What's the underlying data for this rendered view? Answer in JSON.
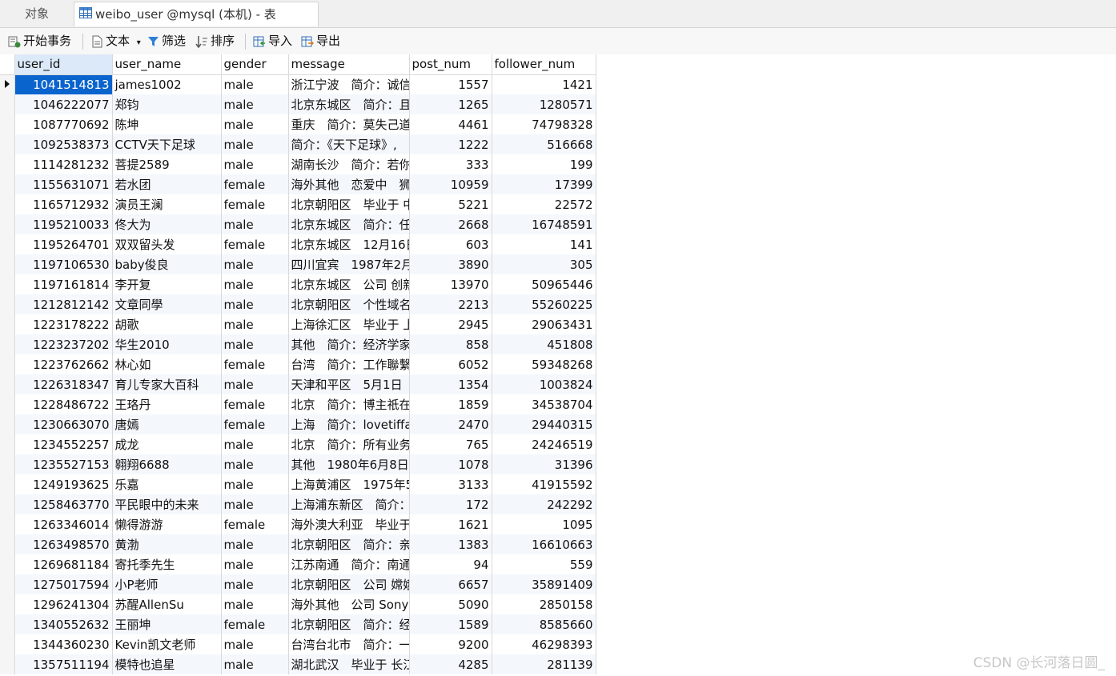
{
  "tabs": {
    "objects_label": "对象",
    "table_label": "weibo_user @mysql (本机) - 表"
  },
  "toolbar": {
    "begin_transaction": "开始事务",
    "text": "文本",
    "filter": "筛选",
    "sort": "排序",
    "import": "导入",
    "export": "导出"
  },
  "columns": [
    "user_id",
    "user_name",
    "gender",
    "message",
    "post_num",
    "follower_num"
  ],
  "rows": [
    [
      "1041514813",
      "james1002",
      "male",
      "浙江宁波　简介：诚信",
      "1557",
      "1421"
    ],
    [
      "1046222077",
      "郑钧",
      "male",
      "北京东城区　简介：且",
      "1265",
      "1280571"
    ],
    [
      "1087770692",
      "陈坤",
      "male",
      "重庆　简介：莫失己道",
      "4461",
      "74798328"
    ],
    [
      "1092538373",
      "CCTV天下足球",
      "male",
      "简介：《天下足球》,",
      "1222",
      "516668"
    ],
    [
      "1114281232",
      "菩提2589",
      "male",
      "湖南长沙　简介：若你",
      "333",
      "199"
    ],
    [
      "1155631071",
      "若水团",
      "female",
      "海外其他　恋爱中　狮",
      "10959",
      "17399"
    ],
    [
      "1165712932",
      "演员王澜",
      "female",
      "北京朝阳区　毕业于 中",
      "5221",
      "22572"
    ],
    [
      "1195210033",
      "佟大为",
      "male",
      "北京东城区　简介：任",
      "2668",
      "16748591"
    ],
    [
      "1195264701",
      "双双留头发",
      "female",
      "北京东城区　12月16日",
      "603",
      "141"
    ],
    [
      "1197106530",
      "baby俊良",
      "male",
      "四川宜宾　1987年2月",
      "3890",
      "305"
    ],
    [
      "1197161814",
      "李开复",
      "male",
      "北京东城区　公司 创新",
      "13970",
      "50965446"
    ],
    [
      "1212812142",
      "文章同學",
      "male",
      "北京朝阳区　个性域名",
      "2213",
      "55260225"
    ],
    [
      "1223178222",
      "胡歌",
      "male",
      "上海徐汇区　毕业于 上",
      "2945",
      "29063431"
    ],
    [
      "1223237202",
      "华生2010",
      "male",
      "其他　简介：经济学家",
      "858",
      "451808"
    ],
    [
      "1223762662",
      "林心如",
      "female",
      "台湾　简介：工作聯繫",
      "6052",
      "59348268"
    ],
    [
      "1226318347",
      "育儿专家大百科",
      "male",
      "天津和平区　5月1日　",
      "1354",
      "1003824"
    ],
    [
      "1228486722",
      "王珞丹",
      "female",
      "北京　简介：博主祇在",
      "1859",
      "34538704"
    ],
    [
      "1230663070",
      "唐嫣",
      "female",
      "上海　简介：lovetiffany",
      "2470",
      "29440315"
    ],
    [
      "1234552257",
      "成龙",
      "male",
      "北京　简介：所有业务",
      "765",
      "24246519"
    ],
    [
      "1235527153",
      "翱翔6688",
      "male",
      "其他　1980年6月8日",
      "1078",
      "31396"
    ],
    [
      "1249193625",
      "乐嘉",
      "male",
      "上海黄浦区　1975年5",
      "3133",
      "41915592"
    ],
    [
      "1258463770",
      "平民眼中的未来",
      "male",
      "上海浦东新区　简介：",
      "172",
      "242292"
    ],
    [
      "1263346014",
      "懒得游游",
      "female",
      "海外澳大利亚　毕业于",
      "1621",
      "1095"
    ],
    [
      "1263498570",
      "黄渤",
      "male",
      "北京朝阳区　简介：亲",
      "1383",
      "16610663"
    ],
    [
      "1269681184",
      "寄托季先生",
      "male",
      "江苏南通　简介：南通",
      "94",
      "559"
    ],
    [
      "1275017594",
      "小P老师",
      "male",
      "北京朝阳区　公司 嫦娥",
      "6657",
      "35891409"
    ],
    [
      "1296241304",
      "苏醒AllenSu",
      "male",
      "海外其他　公司 Sony",
      "5090",
      "2850158"
    ],
    [
      "1340552632",
      "王丽坤",
      "female",
      "北京朝阳区　简介：经",
      "1589",
      "8585660"
    ],
    [
      "1344360230",
      "Kevin凯文老师",
      "male",
      "台湾台北市　简介：一",
      "9200",
      "46298393"
    ],
    [
      "1357511194",
      "模特也追星",
      "male",
      "湖北武汉　毕业于 长江",
      "4285",
      "281139"
    ]
  ],
  "watermark": "CSDN @长河落日圆_",
  "colors": {
    "selected_cell": "#0a64ce",
    "alt_row": "#f4f8fd",
    "active_header": "#dbe9f8"
  }
}
